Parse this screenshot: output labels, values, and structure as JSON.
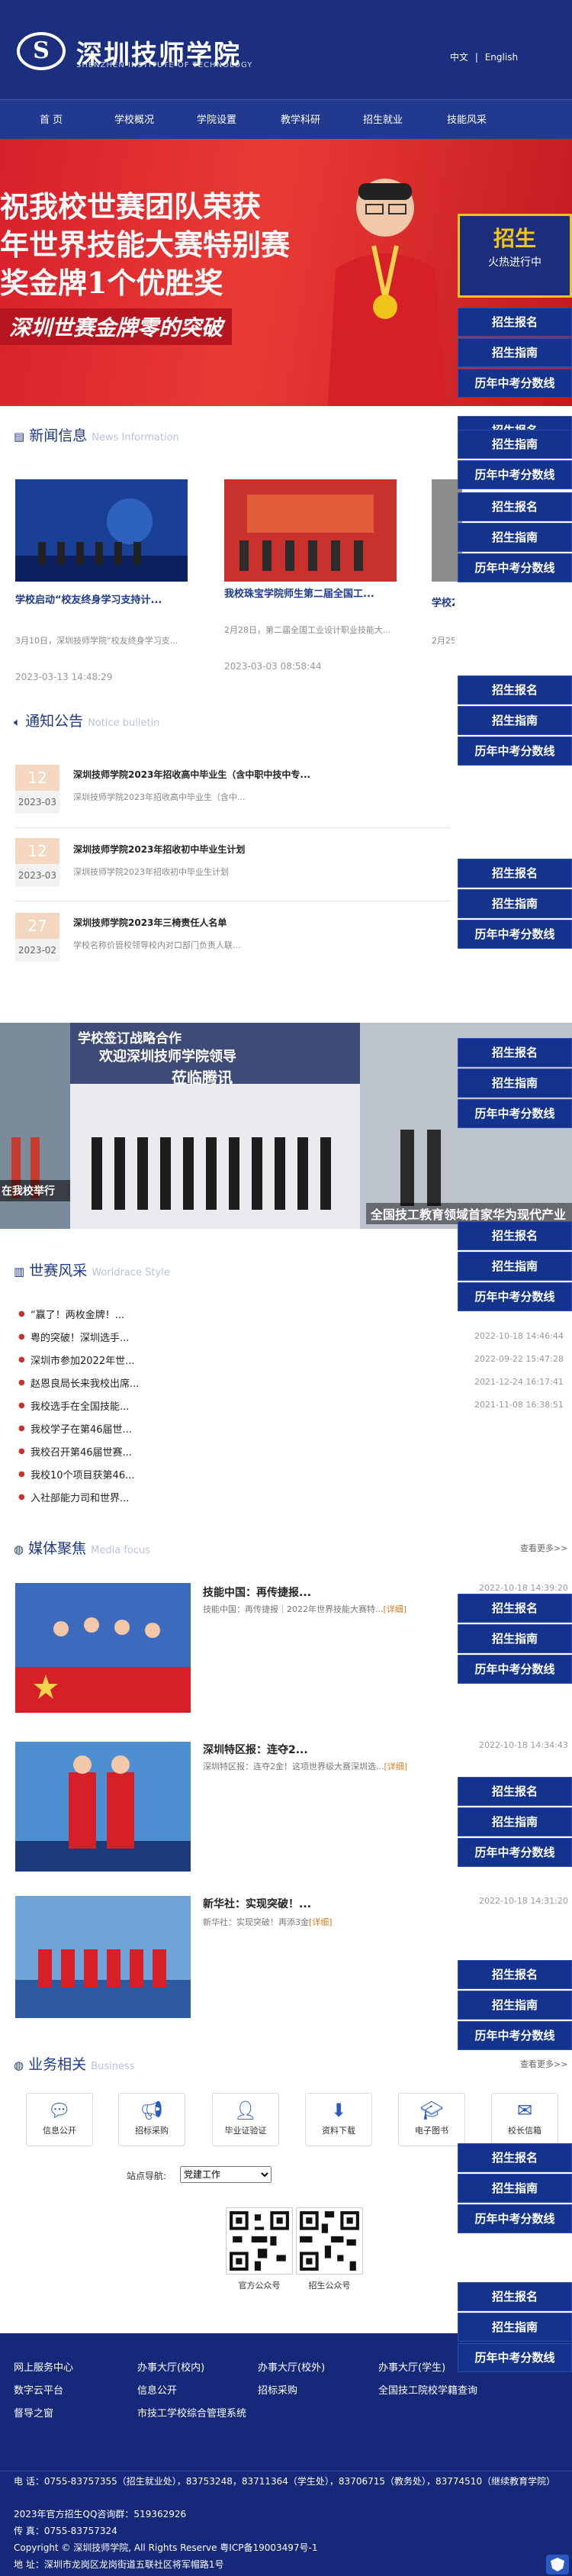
{
  "header": {
    "logo_badge": "S",
    "logo_cn": "深圳技师学院",
    "logo_en": "SHENZHEN INSTITUTE OF TECHNOLOGY",
    "lang_cn": "中文",
    "lang_sep": "|",
    "lang_en": "English"
  },
  "nav": [
    "首 页",
    "学校概况",
    "学院设置",
    "教学科研",
    "招生就业",
    "技能风采"
  ],
  "banner": {
    "line1": "祝我校世赛团队荣获",
    "line2": "年世界技能大赛特别赛",
    "line3": "奖金牌1个优胜奖",
    "line4": "深圳世赛金牌零的突破",
    "recruit1": "招生",
    "recruit2": "火热进行中"
  },
  "side_labels": {
    "enroll": "招生报名",
    "guide": "招生指南",
    "scores": "历年中考分数线"
  },
  "news": {
    "title": "新闻信息",
    "title_en": "News Information",
    "items": [
      {
        "title": "学校启动“校友终身学习支持计...",
        "desc": "3月10日，深圳技师学院“校友终身学习支...",
        "date": "2023-03-13 14:48:29"
      },
      {
        "title": "我校珠宝学院师生第二届全国工...",
        "desc": "2月28日，第二届全国工业设计职业技能大...",
        "date": "2023-03-03 08:58:44"
      },
      {
        "title": "学校2位老师在第三届全国...",
        "desc": "2月25日，第三届全国工院技业能...",
        "date": ""
      }
    ]
  },
  "notice": {
    "title": "通知公告",
    "title_en": "Notice bulletin",
    "items": [
      {
        "day": "12",
        "ym": "2023-03",
        "title": "深圳技师学院2023年招收高中毕业生（含中职中技中专...",
        "desc": "深圳技师学院2023年招收高中毕业生（含中..."
      },
      {
        "day": "12",
        "ym": "2023-03",
        "title": "深圳技师学院2023年招收初中毕业生计划",
        "desc": "深圳技师学院2023年招收初中毕业生计划"
      },
      {
        "day": "27",
        "ym": "2023-02",
        "title": "深圳技师学院2023年三椅责任人名单",
        "desc": "学校名称价管校领导校内对口部门负责人联..."
      }
    ]
  },
  "collage": {
    "cap_left": "在我校举行",
    "cap_mid_top": "欢迎深圳技师学院领导",
    "cap_mid_2": "莅临腾讯",
    "cap_top": "学校签订战略合作",
    "cap_right": "全国技工教育领域首家华为现代产业"
  },
  "worldskills": {
    "title": "世赛风采",
    "title_en": "Worldrace Style",
    "items": [
      {
        "title": "“赢了！两枚金牌！...",
        "date": ""
      },
      {
        "title": "粤的突破！深圳选手...",
        "date": "2022-10-18 14:46:44"
      },
      {
        "title": "深圳市参加2022年世...",
        "date": "2022-09-22 15:47:28"
      },
      {
        "title": "赵恩良局长来我校出席...",
        "date": "2021-12-24 16:17:41"
      },
      {
        "title": "我校选手在全国技能...",
        "date": "2021-11-08 16:38:51"
      },
      {
        "title": "我校学子在第46届世...",
        "date": ""
      },
      {
        "title": "我校召开第46届世赛...",
        "date": ""
      },
      {
        "title": "我校10个项目获第46...",
        "date": ""
      },
      {
        "title": "入社部能力司和世界...",
        "date": ""
      }
    ]
  },
  "media": {
    "title": "媒体聚焦",
    "title_en": "Media focus",
    "more": "查看更多>>",
    "items": [
      {
        "title": "技能中国：再传捷报...",
        "desc": "技能中国：再传捷报｜2022年世界技能大赛特...",
        "detail": "[详细]",
        "date": "2022-10-18 14:39:20"
      },
      {
        "title": "深圳特区报：连夺2...",
        "desc": "深圳特区报：连夺2金！这项世界级大赛深圳选...",
        "detail": "[详细]",
        "date": "2022-10-18 14:34:43"
      },
      {
        "title": "新华社：实现突破！...",
        "desc": "新华社：实现突破！再添3金",
        "detail": "[详细]",
        "date": "2022-10-18 14:31:20"
      }
    ]
  },
  "business": {
    "title": "业务相关",
    "title_en": "Business",
    "more": "查看更多>>",
    "items": [
      {
        "label": "信息公开",
        "icon": "chat-icon"
      },
      {
        "label": "招标采购",
        "icon": "megaphone-icon"
      },
      {
        "label": "毕业证验证",
        "icon": "user-check-icon"
      },
      {
        "label": "资料下载",
        "icon": "download-icon"
      },
      {
        "label": "电子图书",
        "icon": "graduation-cap-icon"
      },
      {
        "label": "校长信箱",
        "icon": "mail-icon"
      }
    ]
  },
  "site_nav": {
    "label": "站点导航:",
    "selected": "党建工作"
  },
  "qr": {
    "left": "官方公众号",
    "right": "招生公众号"
  },
  "footer": {
    "links": [
      [
        "网上服务中心",
        "办事大厅(校内)",
        "办事大厅(校外)",
        "办事大厅(学生)"
      ],
      [
        "数字云平台",
        "信息公开",
        "招标采购",
        "全国技工院校学籍查询"
      ],
      [
        "督导之窗",
        "市技工学校综合管理系统",
        "",
        ""
      ]
    ],
    "phone": "电 话：0755-83757355（招生就业处），83753248，83711364（学生处），83706715（教务处），83774510（继续教育学院）",
    "qq": "2023年官方招生QQ咨询群：519362926",
    "fax": "传 真：0755-83757324",
    "copyright": "Copyright © 深圳技师学院, All Rights Reserve 粤ICP备19003497号-1",
    "address": "地 址：深圳市龙岗区龙岗街道五联社区将军帽路1号"
  },
  "colors": {
    "navy": "#1b2f7e",
    "banner_red": "#d8202b",
    "accent_gold": "#f0c419",
    "link_blue": "#1e3a8c"
  }
}
